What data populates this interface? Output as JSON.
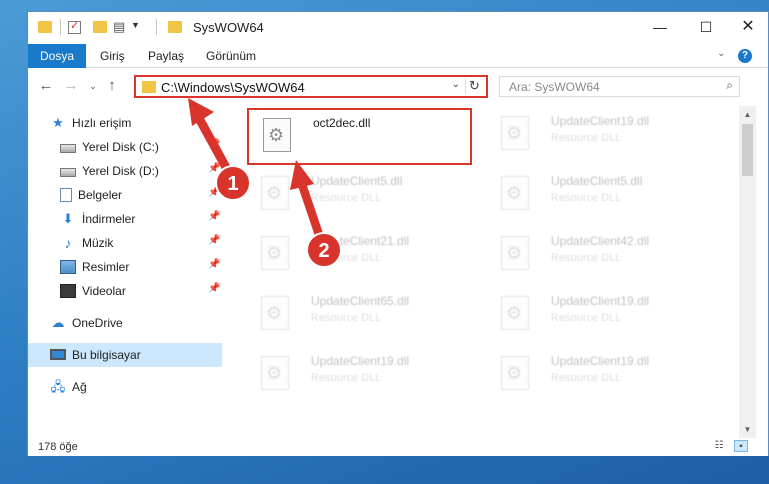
{
  "window": {
    "title": "SysWOW64"
  },
  "ribbon": {
    "tabs": [
      "Dosya",
      "Giriş",
      "Paylaş",
      "Görünüm"
    ]
  },
  "nav": {
    "back_icon": "back-arrow-icon",
    "address": "C:\\Windows\\SysWOW64",
    "search_placeholder": "Ara: SysWOW64"
  },
  "sidebar": {
    "items": [
      {
        "label": "Hızlı erişim",
        "icon": "star-icon"
      },
      {
        "label": "Yerel Disk (C:)",
        "icon": "disk-icon"
      },
      {
        "label": "Yerel Disk (D:)",
        "icon": "disk-icon"
      },
      {
        "label": "Belgeler",
        "icon": "documents-icon"
      },
      {
        "label": "İndirmeler",
        "icon": "downloads-icon"
      },
      {
        "label": "Müzik",
        "icon": "music-icon"
      },
      {
        "label": "Resimler",
        "icon": "pictures-icon"
      },
      {
        "label": "Videolar",
        "icon": "videos-icon"
      },
      {
        "label": "OneDrive",
        "icon": "cloud-icon"
      },
      {
        "label": "Bu bilgisayar",
        "icon": "pc-icon"
      },
      {
        "label": "Ağ",
        "icon": "network-icon"
      }
    ]
  },
  "files": [
    {
      "name": "oct2dec.dll",
      "desc": ""
    },
    {
      "name": "UpdateClient19.dll",
      "desc": "Resource DLL"
    },
    {
      "name": "UpdateClient5.dll",
      "desc": "Resource DLL"
    },
    {
      "name": "UpdateClient5.dll",
      "desc": "Resource DLL"
    },
    {
      "name": "UpdateClient21.dll",
      "desc": "Resource DLL"
    },
    {
      "name": "UpdateClient42.dll",
      "desc": "Resource DLL"
    },
    {
      "name": "UpdateClient65.dll",
      "desc": "Resource DLL"
    },
    {
      "name": "UpdateClient19.dll",
      "desc": "Resource DLL"
    },
    {
      "name": "UpdateClient19.dll",
      "desc": "Resource DLL"
    },
    {
      "name": "UpdateClient19.dll",
      "desc": "Resource DLL"
    }
  ],
  "status": {
    "count": "178 öğe"
  },
  "annotations": {
    "step1": "1",
    "step2": "2",
    "color": "#d9342b"
  }
}
